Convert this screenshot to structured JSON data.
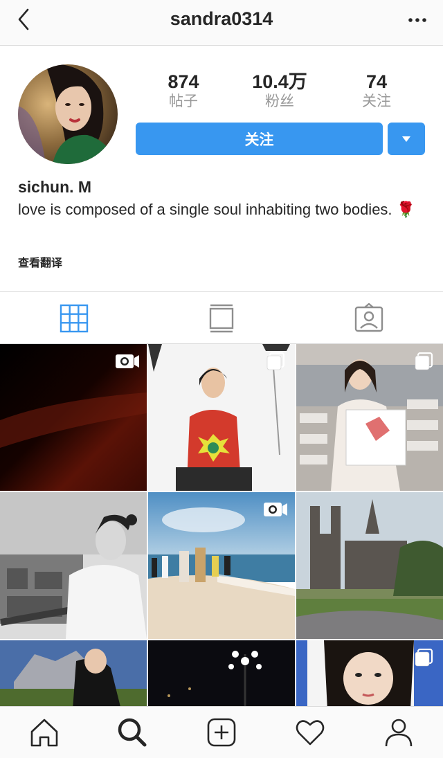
{
  "header": {
    "username": "sandra0314",
    "back_icon": "chevron-left-icon",
    "more_icon": "more-horizontal-icon"
  },
  "profile": {
    "stats": [
      {
        "value": "874",
        "label": "帖子"
      },
      {
        "value": "10.4万",
        "label": "粉丝"
      },
      {
        "value": "74",
        "label": "关注"
      }
    ],
    "follow_label": "关注",
    "display_name": "sichun. M",
    "bio": "love is composed of a single soul inhabiting two bodies.",
    "bio_emoji": "🌹",
    "translate_label": "查看翻译"
  },
  "tabs": [
    {
      "name": "grid",
      "icon": "grid-icon",
      "active": true
    },
    {
      "name": "feed",
      "icon": "feed-icon",
      "active": false
    },
    {
      "name": "tagged",
      "icon": "tagged-person-icon",
      "active": false
    }
  ],
  "grid_posts": [
    {
      "scene": "dark-red-gradient",
      "badge": "video-icon"
    },
    {
      "scene": "studio-red-sweater",
      "badge": "multi-photo-icon"
    },
    {
      "scene": "runway-chanel-bag",
      "badge": "multi-photo-icon"
    },
    {
      "scene": "bw-portrait-balcony",
      "badge": ""
    },
    {
      "scene": "beach-runway",
      "badge": "video-icon"
    },
    {
      "scene": "notre-dame",
      "badge": ""
    },
    {
      "scene": "mountain-portrait",
      "badge": ""
    },
    {
      "scene": "night-lamp",
      "badge": ""
    },
    {
      "scene": "closeup-face",
      "badge": "multi-photo-icon"
    }
  ],
  "bottom_nav": [
    {
      "icon": "home-icon"
    },
    {
      "icon": "search-icon",
      "active": true
    },
    {
      "icon": "add-post-icon"
    },
    {
      "icon": "heart-icon"
    },
    {
      "icon": "profile-icon"
    }
  ],
  "colors": {
    "accent": "#3897f0",
    "text": "#262626",
    "muted": "#999999",
    "border": "#dbdbdb"
  }
}
